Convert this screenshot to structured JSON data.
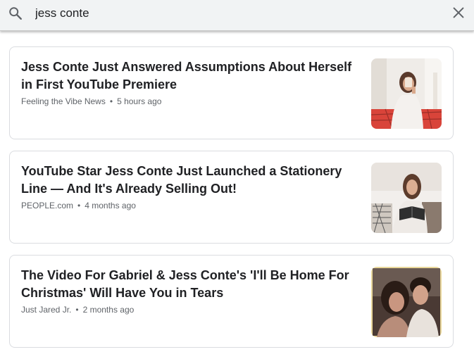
{
  "search": {
    "query": "jess conte",
    "search_icon": "search-icon",
    "clear_icon": "close-icon"
  },
  "results": [
    {
      "title": "Jess Conte Just Answered Assumptions About Herself in First YouTube Premiere",
      "source": "Feeling the Vibe News",
      "separator": "•",
      "time": "5 hours ago",
      "thumb_colors": [
        "#efece8",
        "#d9443a",
        "#6b4a3a"
      ]
    },
    {
      "title": "YouTube Star Jess Conte Just Launched a Stationery Line — And It's Already Selling Out!",
      "source": "PEOPLE.com",
      "separator": "•",
      "time": "4 months ago",
      "thumb_colors": [
        "#f2efec",
        "#6b4a3a",
        "#3b3b3b"
      ]
    },
    {
      "title": "The Video For Gabriel & Jess Conte's 'I'll Be Home For Christmas' Will Have You in Tears",
      "source": "Just Jared Jr.",
      "separator": "•",
      "time": "2 months ago",
      "thumb_colors": [
        "#e9d79a",
        "#3a2a24",
        "#b88d7a"
      ]
    }
  ]
}
